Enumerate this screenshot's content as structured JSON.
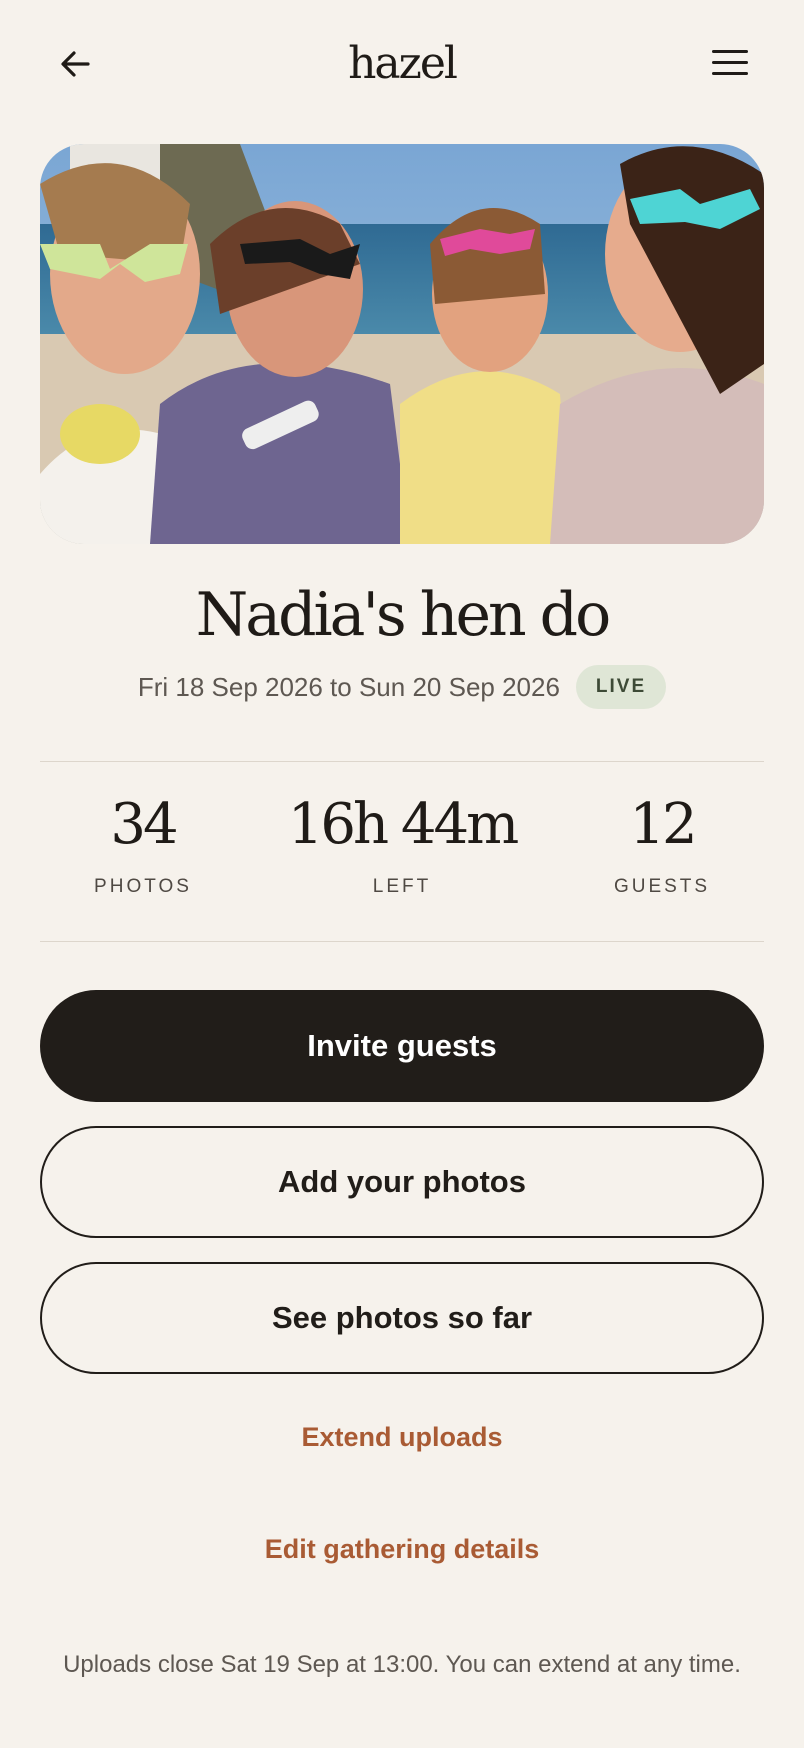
{
  "header": {
    "logo": "hazel",
    "back_icon": "arrow-left-icon",
    "menu_icon": "hamburger-menu-icon"
  },
  "hero": {
    "image_alt": "group-photo"
  },
  "event": {
    "title": "Nadia's hen do",
    "dates": "Fri 18 Sep 2026 to Sun 20 Sep 2026",
    "status": "LIVE"
  },
  "stats": {
    "photos": {
      "value": "34",
      "label": "PHOTOS"
    },
    "time_left": {
      "value": "16h 44m",
      "label": "LEFT"
    },
    "guests": {
      "value": "12",
      "label": "GUESTS"
    }
  },
  "actions": {
    "invite": "Invite guests",
    "add_photos": "Add your photos",
    "see_photos": "See photos so far",
    "extend": "Extend uploads",
    "edit": "Edit gathering details"
  },
  "footnote": "Uploads close Sat 19 Sep at 13:00. You can extend at any time.",
  "colors": {
    "background": "#f6f2ec",
    "primary": "#211d19",
    "accent": "#a95b34",
    "live_badge": "#dfe6d6"
  }
}
